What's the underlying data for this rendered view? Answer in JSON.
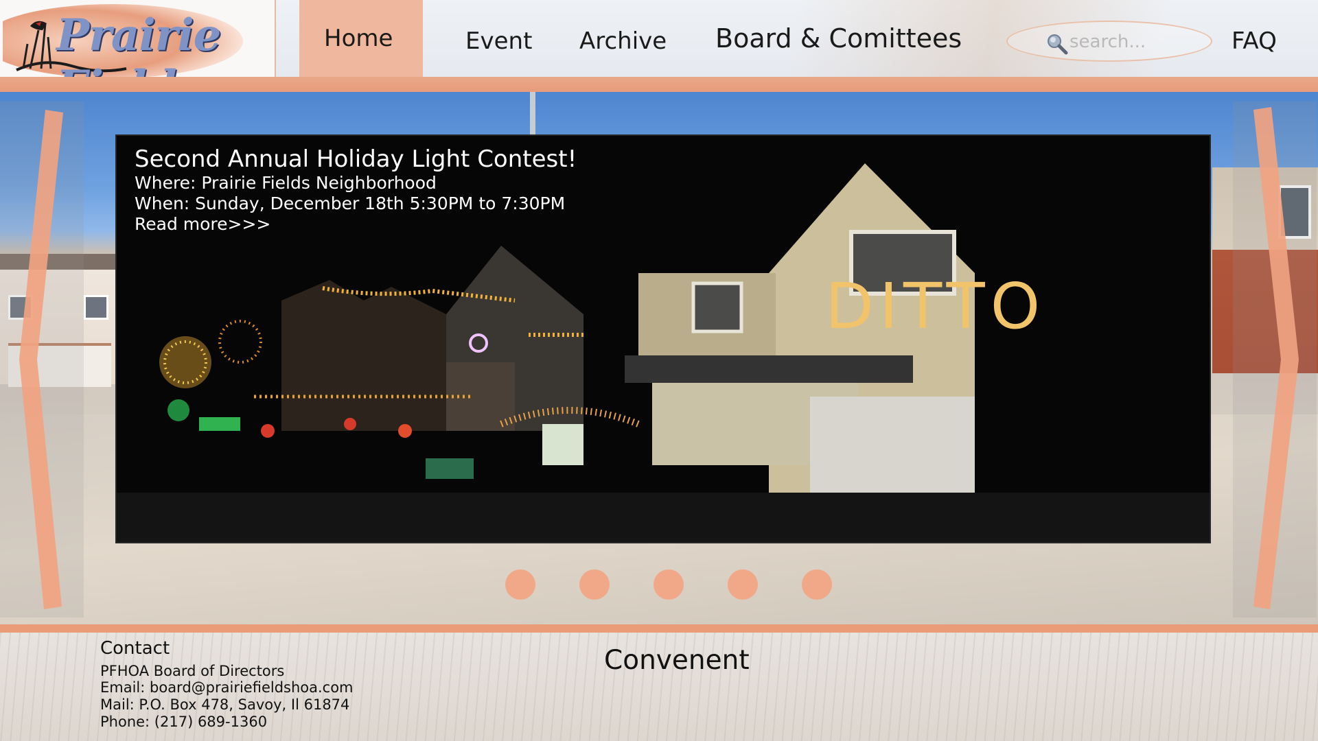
{
  "header": {
    "logo_text": "Prairie Fields",
    "nav": {
      "home": "Home",
      "event": "Event",
      "archive": "Archive",
      "board": "Board & Comittees",
      "faq": "FAQ"
    },
    "search": {
      "placeholder": "search...",
      "icon": "magnifier-icon"
    }
  },
  "slideshow": {
    "title": "Second Annual Holiday Light Contest!",
    "where": "Where: Prairie Fields Neighborhood",
    "when": "When: Sunday, December 18th 5:30PM to 7:30PM",
    "read_more": "Read more>>>",
    "house_sign": "DITTO",
    "indicator_count": 5,
    "accent_color": "#f1a888"
  },
  "footer": {
    "contact_title": "Contact",
    "contact_lines": [
      "PFHOA Board of Directors",
      "Email: board@prairiefieldshoa.com",
      "Mail: P.O. Box 478, Savoy, Il  61874",
      "Phone: (217) 689-1360"
    ],
    "convenient_heading": "Convenent"
  },
  "colors": {
    "brand_peach": "#efb79d",
    "strip": "#e79c7c",
    "logo_blue": "#7f93c6"
  }
}
